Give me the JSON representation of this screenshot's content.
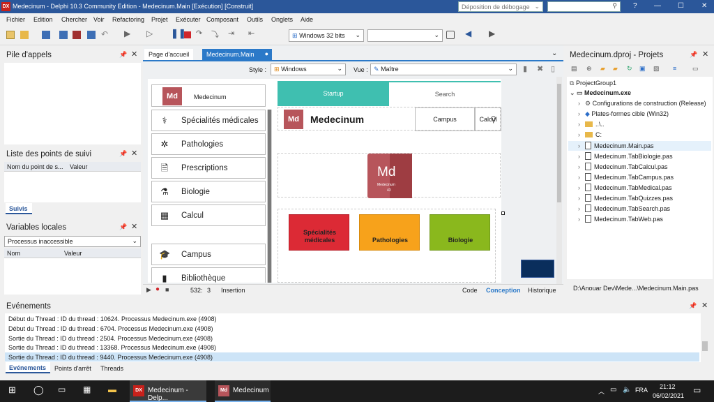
{
  "window": {
    "title": "Medecinum - Delphi 10.3 Community Edition - Medecinum.Main [Exécution] [Construit]",
    "logo": "DX",
    "layout_combo": "Déposition de débogage"
  },
  "menu": [
    "Fichier",
    "Edition",
    "Chercher",
    "Voir",
    "Refactoring",
    "Projet",
    "Exécuter",
    "Composant",
    "Outils",
    "Onglets",
    "Aide"
  ],
  "toolbar": {
    "platform": "Windows 32 bits",
    "config": ""
  },
  "left": {
    "call_stack": {
      "title": "Pile d'appels"
    },
    "watch": {
      "title": "Liste des points de suivi",
      "col1": "Nom du point de s...",
      "col2": "Valeur",
      "tab": "Suivis"
    },
    "locals": {
      "title": "Variables locales",
      "combo": "Processus inaccessible",
      "col1": "Nom",
      "col2": "Valeur"
    }
  },
  "doc": {
    "tabs": [
      "Page d'accueil",
      "Medecinum.Main"
    ],
    "style_label": "Style :",
    "style_value": "Windows",
    "view_label": "Vue :",
    "view_value": "Maître",
    "app": {
      "logo_text": "Medecinum",
      "header_title": "Medecinum",
      "top_tabs": [
        "Startup",
        "Search"
      ],
      "header_buttons": [
        "Campus",
        "Calcul"
      ],
      "big_logo": {
        "symbol": "Md",
        "name": "Medecinum",
        "number": "43"
      },
      "side_items": [
        "Spécialités médicales",
        "Pathologies",
        "Prescriptions",
        "Biologie",
        "Calcul",
        "Campus",
        "Bibliothèque"
      ],
      "tiles": [
        {
          "label": "Spécialités\nmédicales",
          "color": "#dc2a35"
        },
        {
          "label": "Pathologies",
          "color": "#f7a21b"
        },
        {
          "label": "Biologie",
          "color": "#8ab81d"
        }
      ]
    },
    "status": {
      "pos": "532:",
      "col": "3",
      "mode": "Insertion"
    },
    "bottom_tabs": [
      "Code",
      "Conception",
      "Historique"
    ]
  },
  "project": {
    "title": "Medecinum.dproj - Projets",
    "items": [
      "ProjectGroup1",
      "Medecinum.exe",
      "Configurations de construction (Release)",
      "Plates-formes cible (Win32)",
      "..\\..",
      "C:",
      "Medecinum.Main.pas",
      "Medecinum.TabBiologie.pas",
      "Medecinum.TabCalcul.pas",
      "Medecinum.TabCampus.pas",
      "Medecinum.TabMedical.pas",
      "Medecinum.TabQuizzes.pas",
      "Medecinum.TabSearch.pas",
      "Medecinum.TabWeb.pas"
    ],
    "path": "D:\\Anouar Dev\\Mede...\\Medecinum.Main.pas"
  },
  "events": {
    "title": "Evénements",
    "lines": [
      "Début du Thread : ID du thread : 10624. Processus Medecinum.exe (4908)",
      "Début du Thread : ID du thread : 6704. Processus Medecinum.exe (4908)",
      "Sortie du Thread : ID du thread : 2504. Processus Medecinum.exe (4908)",
      "Sortie du Thread : ID du thread : 13368. Processus Medecinum.exe (4908)",
      "Sortie du Thread : ID du thread : 9440. Processus Medecinum.exe (4908)"
    ],
    "tabs": [
      "Evénements",
      "Points d'arrêt",
      "Threads"
    ]
  },
  "taskbar": {
    "apps": [
      "Medecinum - Delp...",
      "Medecinum"
    ],
    "lang": "FRA",
    "time": "21:12",
    "date": "06/02/2021"
  },
  "colors": {
    "accent": "#2b579a",
    "teal": "#3fbfb0",
    "brand": "#9e3d42",
    "selected": "#cde4f7"
  }
}
